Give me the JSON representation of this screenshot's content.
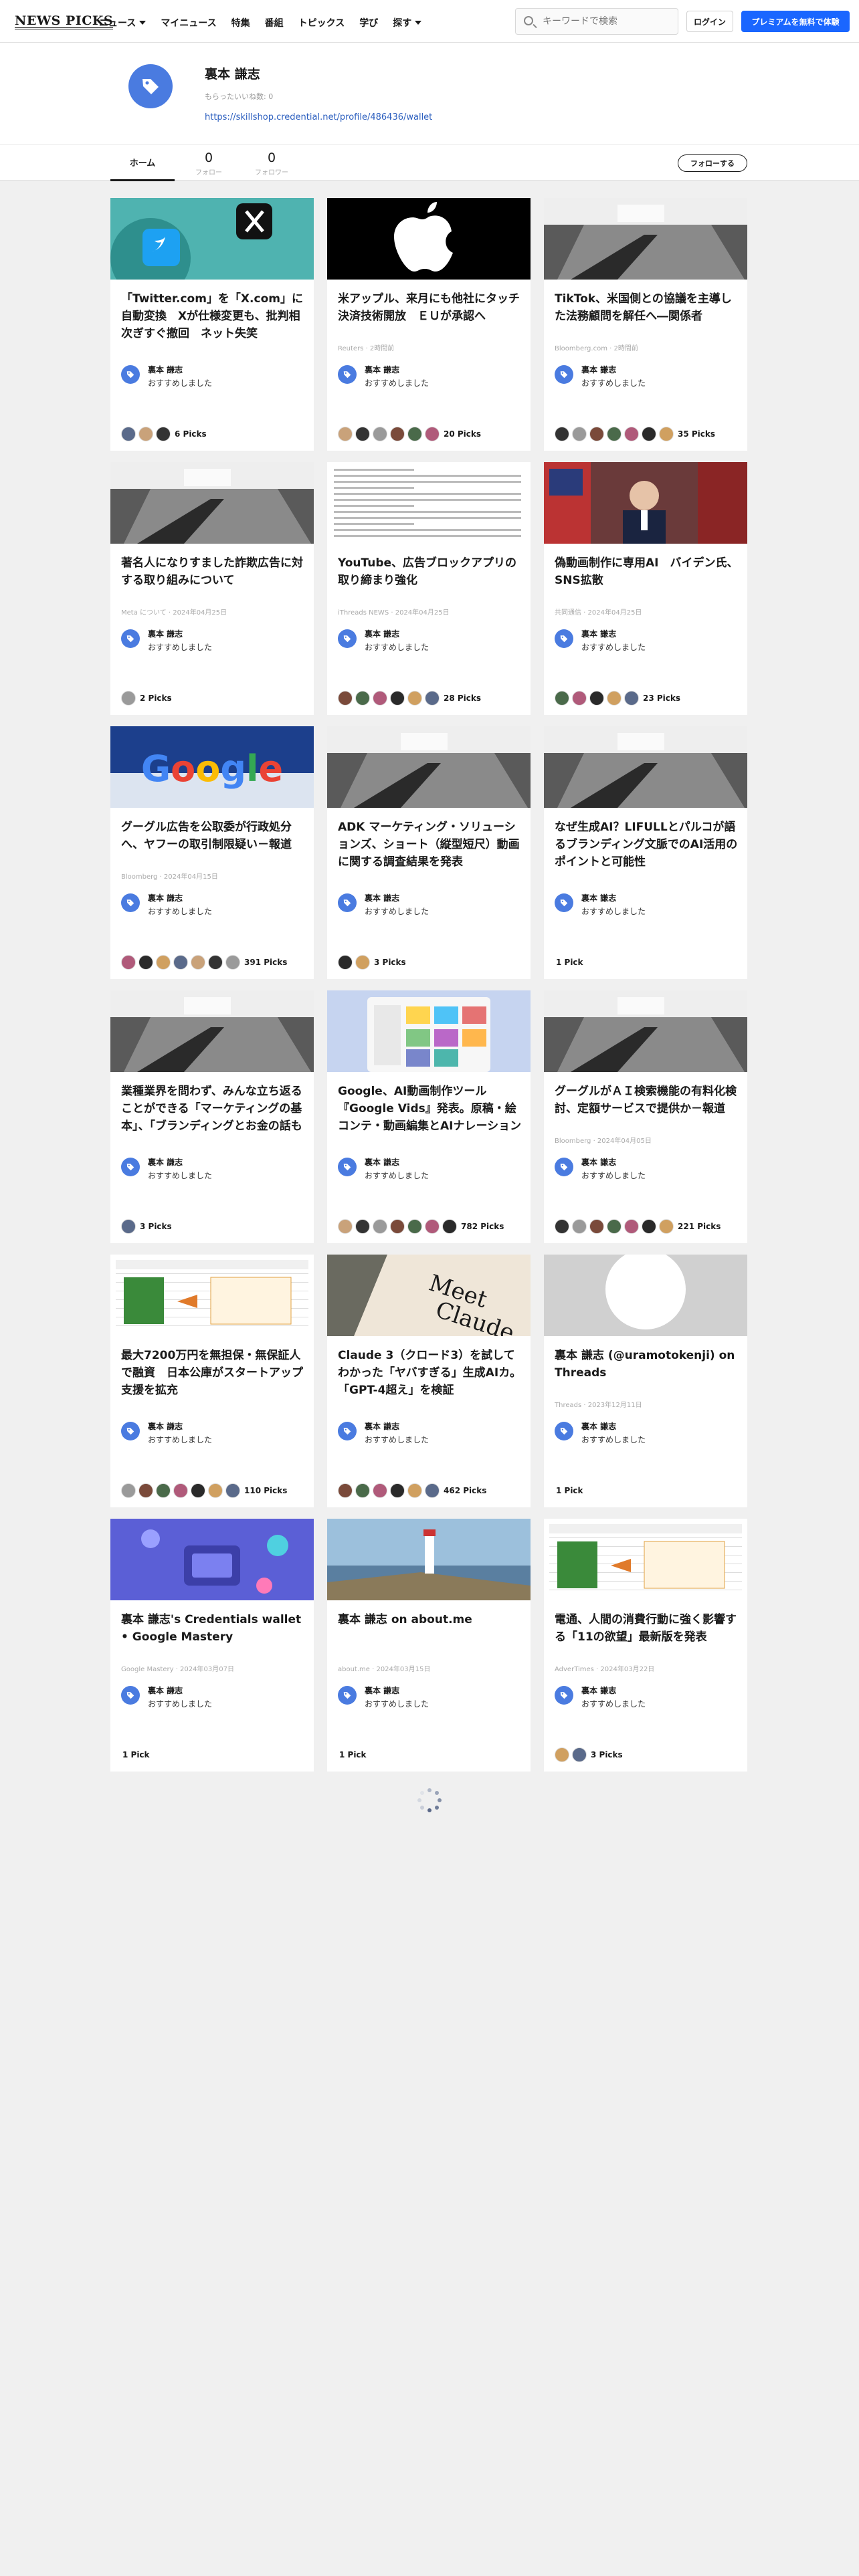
{
  "header": {
    "logo": "NEWS PICKS",
    "nav": [
      {
        "label": "ニュース",
        "has_caret": true
      },
      {
        "label": "マイニュース",
        "has_caret": false
      },
      {
        "label": "特集",
        "has_caret": false
      },
      {
        "label": "番組",
        "has_caret": false
      },
      {
        "label": "トピックス",
        "has_caret": false
      },
      {
        "label": "学び",
        "has_caret": false
      },
      {
        "label": "探す",
        "has_caret": true
      }
    ],
    "search_placeholder": "キーワードで検索",
    "login_label": "ログイン",
    "premium_label": "プレミアムを無料で体験"
  },
  "profile": {
    "name": "裏本 謙志",
    "meta": "もらったいいね数: 0",
    "link": "https://skillshop.credential.net/profile/486436/wallet",
    "tab_home": "ホーム",
    "following_count": "0",
    "following_label": "フォロー",
    "followers_count": "0",
    "followers_label": "フォロワー",
    "follow_button": "フォローする"
  },
  "picker": {
    "name": "裏本 謙志",
    "recommend": "おすすめしました"
  },
  "colors": {
    "accent": "#1a66ff",
    "picker_blue": "#4a7be0"
  },
  "cards": [
    {
      "title": "「Twitter.com」を「X.com」に自動変換　Xが仕様変更も、批判相次ぎすぐ撤回　ネット失笑",
      "source": "",
      "picks": "6 Picks",
      "avatars": 3,
      "thumb": "twitter"
    },
    {
      "title": "米アップル、来月にも他社にタッチ決済技術開放　ＥＵが承認へ",
      "source": "Reuters · 2時間前",
      "picks": "20 Picks",
      "avatars": 6,
      "thumb": "apple"
    },
    {
      "title": "TikTok、米国側との協議を主導した法務顧問を解任へ―関係者",
      "source": "Bloomberg.com · 2時間前",
      "picks": "35 Picks",
      "avatars": 7,
      "thumb": "room"
    },
    {
      "title": "著名人になりすました詐欺広告に対する取り組みについて",
      "source": "Meta について · 2024年04月25日",
      "picks": "2 Picks",
      "avatars": 1,
      "thumb": "room"
    },
    {
      "title": "YouTube、広告ブロックアプリの取り締まり強化",
      "source": "iThreads NEWS · 2024年04月25日",
      "picks": "28 Picks",
      "avatars": 6,
      "thumb": "doc"
    },
    {
      "title": "偽動画制作に専用AI　バイデン氏、SNS拡散",
      "source": "共同通信 · 2024年04月25日",
      "picks": "23 Picks",
      "avatars": 5,
      "thumb": "biden"
    },
    {
      "title": "グーグル広告を公取委が行政処分へ、ヤフーの取引制限疑い－報道",
      "source": "Bloomberg · 2024年04月15日",
      "picks": "391 Picks",
      "avatars": 7,
      "thumb": "google"
    },
    {
      "title": "ADK マーケティング・ソリューションズ、ショート（縦型短尺）動画 に関する調査結果を発表",
      "source": "",
      "picks": "3 Picks",
      "avatars": 2,
      "thumb": "room"
    },
    {
      "title": "なぜ生成AI？LIFULLとパルコが語るブランディング文脈でのAI活用のポイントと可能性",
      "source": "",
      "picks": "1 Pick",
      "avatars": 0,
      "thumb": "room"
    },
    {
      "title": "業種業界を問わず、みんな立ち返ることができる「マーケティングの基本」、「ブランディングとお金の話も",
      "source": "",
      "picks": "3 Picks",
      "avatars": 1,
      "thumb": "room"
    },
    {
      "title": "Google、AI動画制作ツール『Google Vids』発表。原稿・絵コンテ・動画編集とAIナレーションまでワンストップの新しいWorkspaceアプリ",
      "source": "",
      "picks": "782 Picks",
      "avatars": 7,
      "thumb": "vids"
    },
    {
      "title": "グーグルがＡＩ検索機能の有料化検討、定額サービスで提供か－報道",
      "source": "Bloomberg · 2024年04月05日",
      "picks": "221 Picks",
      "avatars": 7,
      "thumb": "room"
    },
    {
      "title": "最大7200万円を無担保・無保証人で融資　日本公庫がスタートアップ支援を拡充",
      "source": "",
      "picks": "110 Picks",
      "avatars": 7,
      "thumb": "table"
    },
    {
      "title": "Claude 3（クロード3）を試してわかった「ヤバすぎる」生成AIカ。「GPT-4超え」を検証",
      "source": "",
      "picks": "462 Picks",
      "avatars": 6,
      "thumb": "claude"
    },
    {
      "title": "裏本 謙志 (@uramotokenji) on Threads",
      "source": "Threads · 2023年12月11日",
      "picks": "1 Pick",
      "avatars": 0,
      "thumb": "threads"
    },
    {
      "title": "裏本 謙志's Credentials wallet • Google Mastery",
      "source": "Google Mastery · 2024年03月07日",
      "picks": "1 Pick",
      "avatars": 0,
      "thumb": "wallet"
    },
    {
      "title": "裏本 謙志 on about.me",
      "source": "about.me · 2024年03月15日",
      "picks": "1 Pick",
      "avatars": 0,
      "thumb": "lighthouse"
    },
    {
      "title": "電通、人間の消費行動に強く影響する「11の欲望」最新版を発表",
      "source": "AdverTimes · 2024年03月22日",
      "picks": "3 Picks",
      "avatars": 2,
      "thumb": "table"
    }
  ]
}
